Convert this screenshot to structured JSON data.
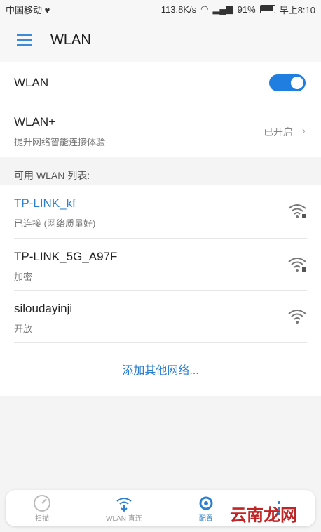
{
  "status_bar": {
    "carrier": "中国移动",
    "speed": "113.8K/s",
    "battery": "91%",
    "time": "早上8:10"
  },
  "app_bar": {
    "title": "WLAN"
  },
  "wlan_toggle": {
    "label": "WLAN",
    "state": "on"
  },
  "wlan_plus": {
    "title": "WLAN+",
    "subtitle": "提升网络智能连接体验",
    "value": "已开启"
  },
  "section_header": "可用 WLAN 列表:",
  "networks": [
    {
      "ssid": "TP-LINK_kf",
      "status": "已连接 (网络质量好)",
      "locked": true
    },
    {
      "ssid": "TP-LINK_5G_A97F",
      "status": "加密",
      "locked": true
    },
    {
      "ssid": "siloudayinji",
      "status": "开放",
      "locked": false
    }
  ],
  "add_network": "添加其他网络...",
  "bottom_nav": {
    "items": [
      {
        "label": "扫描",
        "icon": "scan-icon"
      },
      {
        "label": "WLAN 直连",
        "icon": "wlan-direct-icon"
      },
      {
        "label": "配置",
        "icon": "gear-icon"
      },
      {
        "label": "",
        "icon": "more-icon"
      }
    ]
  },
  "watermark": "云南龙网",
  "colors": {
    "accent": "#2c80cf",
    "toggle": "#1f7ee0"
  }
}
